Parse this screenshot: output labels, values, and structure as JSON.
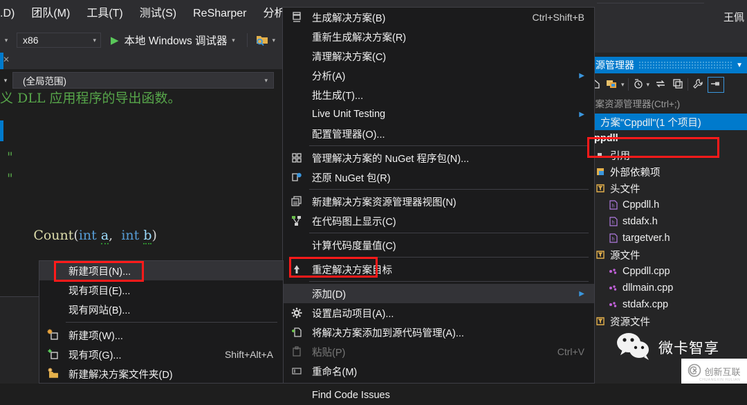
{
  "menubar": {
    "items": [
      {
        "label": ".D)"
      },
      {
        "label": "团队(M)"
      },
      {
        "label": "工具(T)"
      },
      {
        "label": "测试(S)"
      },
      {
        "label": "ReSharper"
      },
      {
        "label": "分析(N"
      }
    ]
  },
  "toolbar": {
    "platform_value": "x86",
    "run_label": "本地 Windows 调试器",
    "folder_icon": "folder-search-icon",
    "play_icon": "play-icon"
  },
  "user": {
    "name": "王佩"
  },
  "editor": {
    "navigation_scope": "(全局范围)",
    "code_lines": [
      {
        "text": "义 DLL 应用程序的导出函数。",
        "kind": "comment"
      },
      {
        "text": "\"",
        "kind": "comment"
      },
      {
        "text": "\"",
        "kind": "comment"
      }
    ],
    "signature": {
      "name": "Count",
      "open": "(",
      "type1": "int",
      "param1": "a",
      "comma": ",",
      "type2": "int",
      "param2": "b",
      "close": ")"
    }
  },
  "context_menu": {
    "items": [
      {
        "label": "生成解决方案(B)",
        "shortcut": "Ctrl+Shift+B",
        "icon": "build-icon",
        "arrow": false,
        "disabled": false,
        "highlighted": false
      },
      {
        "label": "重新生成解决方案(R)",
        "shortcut": "",
        "icon": "",
        "arrow": false,
        "disabled": false,
        "highlighted": false
      },
      {
        "label": "清理解决方案(C)",
        "shortcut": "",
        "icon": "",
        "arrow": false,
        "disabled": false,
        "highlighted": false
      },
      {
        "label": "分析(A)",
        "shortcut": "",
        "icon": "",
        "arrow": true,
        "disabled": false,
        "highlighted": false
      },
      {
        "label": "批生成(T)...",
        "shortcut": "",
        "icon": "",
        "arrow": false,
        "disabled": false,
        "highlighted": false
      },
      {
        "label": "Live Unit Testing",
        "shortcut": "",
        "icon": "",
        "arrow": true,
        "disabled": false,
        "highlighted": false
      },
      {
        "label": "配置管理器(O)...",
        "shortcut": "",
        "icon": "",
        "arrow": false,
        "disabled": false,
        "highlighted": false
      },
      {
        "separator": true
      },
      {
        "label": "管理解决方案的 NuGet 程序包(N)...",
        "shortcut": "",
        "icon": "nuget-manage-icon",
        "arrow": false,
        "disabled": false,
        "highlighted": false
      },
      {
        "label": "还原 NuGet 包(R)",
        "shortcut": "",
        "icon": "nuget-restore-icon",
        "arrow": false,
        "disabled": false,
        "highlighted": false
      },
      {
        "separator": true
      },
      {
        "label": "新建解决方案资源管理器视图(N)",
        "shortcut": "",
        "icon": "new-explorer-view-icon",
        "arrow": false,
        "disabled": false,
        "highlighted": false
      },
      {
        "label": "在代码图上显示(C)",
        "shortcut": "",
        "icon": "code-map-icon",
        "arrow": false,
        "disabled": false,
        "highlighted": false
      },
      {
        "separator": true
      },
      {
        "label": "计算代码度量值(C)",
        "shortcut": "",
        "icon": "",
        "arrow": false,
        "disabled": false,
        "highlighted": false
      },
      {
        "separator": true
      },
      {
        "label": "重定解决方案目标",
        "shortcut": "",
        "icon": "retarget-icon",
        "arrow": false,
        "disabled": false,
        "highlighted": false
      },
      {
        "separator": true
      },
      {
        "label": "添加(D)",
        "shortcut": "",
        "icon": "",
        "arrow": true,
        "disabled": false,
        "highlighted": true
      },
      {
        "label": "设置启动项目(A)...",
        "shortcut": "",
        "icon": "gear-icon",
        "arrow": false,
        "disabled": false,
        "highlighted": false
      },
      {
        "label": "将解决方案添加到源代码管理(A)...",
        "shortcut": "",
        "icon": "add-source-control-icon",
        "arrow": false,
        "disabled": false,
        "highlighted": false
      },
      {
        "label": "粘贴(P)",
        "shortcut": "Ctrl+V",
        "icon": "paste-icon",
        "arrow": false,
        "disabled": true,
        "highlighted": false
      },
      {
        "label": "重命名(M)",
        "shortcut": "",
        "icon": "rename-icon",
        "arrow": false,
        "disabled": false,
        "highlighted": false
      },
      {
        "separator": true
      },
      {
        "label": "Find Code Issues",
        "shortcut": "",
        "icon": "",
        "arrow": false,
        "disabled": false,
        "highlighted": false
      }
    ]
  },
  "submenu": {
    "items": [
      {
        "label": "新建项目(N)...",
        "shortcut": "",
        "icon": "",
        "highlighted": true
      },
      {
        "label": "现有项目(E)...",
        "shortcut": "",
        "icon": "",
        "highlighted": false
      },
      {
        "label": "现有网站(B)...",
        "shortcut": "",
        "icon": "",
        "highlighted": false
      },
      {
        "separator": true
      },
      {
        "label": "新建项(W)...",
        "shortcut": "",
        "icon": "new-item-icon",
        "highlighted": false
      },
      {
        "label": "现有项(G)...",
        "shortcut": "Shift+Alt+A",
        "icon": "existing-item-icon",
        "highlighted": false
      },
      {
        "label": "新建解决方案文件夹(D)",
        "shortcut": "",
        "icon": "new-folder-icon",
        "highlighted": false
      }
    ]
  },
  "solution_explorer": {
    "title": "资源管理器",
    "search_placeholder": "方案资源管理器(Ctrl+;)",
    "toolbar_icons": [
      "home-icon",
      "sync-with-document-icon",
      "dropdown-icon",
      "pending-changes-icon",
      "dropdown2-icon",
      "refresh-icon",
      "collapse-all-icon",
      "properties-icon",
      "show-all-files-icon"
    ],
    "tree": [
      {
        "label": "方案\"Cppdll\"(1 个项目)",
        "icon": "solution-icon",
        "indent": 0,
        "selected": true
      },
      {
        "label": "ppdll",
        "icon": "project-icon",
        "indent": 1,
        "selected": false
      },
      {
        "label": "引用",
        "icon": "references-icon",
        "indent": 2,
        "selected": false
      },
      {
        "label": "外部依赖项",
        "icon": "external-deps-icon",
        "indent": 2,
        "selected": false
      },
      {
        "label": "头文件",
        "icon": "folder-filter-icon",
        "indent": 2,
        "selected": false
      },
      {
        "label": "Cppdll.h",
        "icon": "header-file-icon",
        "indent": 3,
        "selected": false
      },
      {
        "label": "stdafx.h",
        "icon": "header-file-icon",
        "indent": 3,
        "selected": false
      },
      {
        "label": "targetver.h",
        "icon": "header-file-icon",
        "indent": 3,
        "selected": false
      },
      {
        "label": "源文件",
        "icon": "folder-filter-icon",
        "indent": 2,
        "selected": false
      },
      {
        "label": "Cppdll.cpp",
        "icon": "cpp-file-icon",
        "indent": 3,
        "selected": false
      },
      {
        "label": "dllmain.cpp",
        "icon": "cpp-file-icon",
        "indent": 3,
        "selected": false
      },
      {
        "label": "stdafx.cpp",
        "icon": "cpp-file-icon",
        "indent": 3,
        "selected": false
      },
      {
        "label": "资源文件",
        "icon": "folder-filter-icon",
        "indent": 2,
        "selected": false
      }
    ]
  },
  "watermarks": {
    "wechat_label": "微卡智享",
    "wechat_icon": "wechat-icon",
    "corner_text": "创新互联",
    "corner_sub": "CHUANGXIN HULIAN"
  },
  "colors": {
    "accent": "#007acc",
    "annotation": "#ff1a1a",
    "menu_bg": "#1b1b1c",
    "toolbar_bg": "#2d2d30",
    "editor_bg": "#1e1e1e",
    "comment_green": "#57a64a",
    "keyword_blue": "#569cd6"
  }
}
